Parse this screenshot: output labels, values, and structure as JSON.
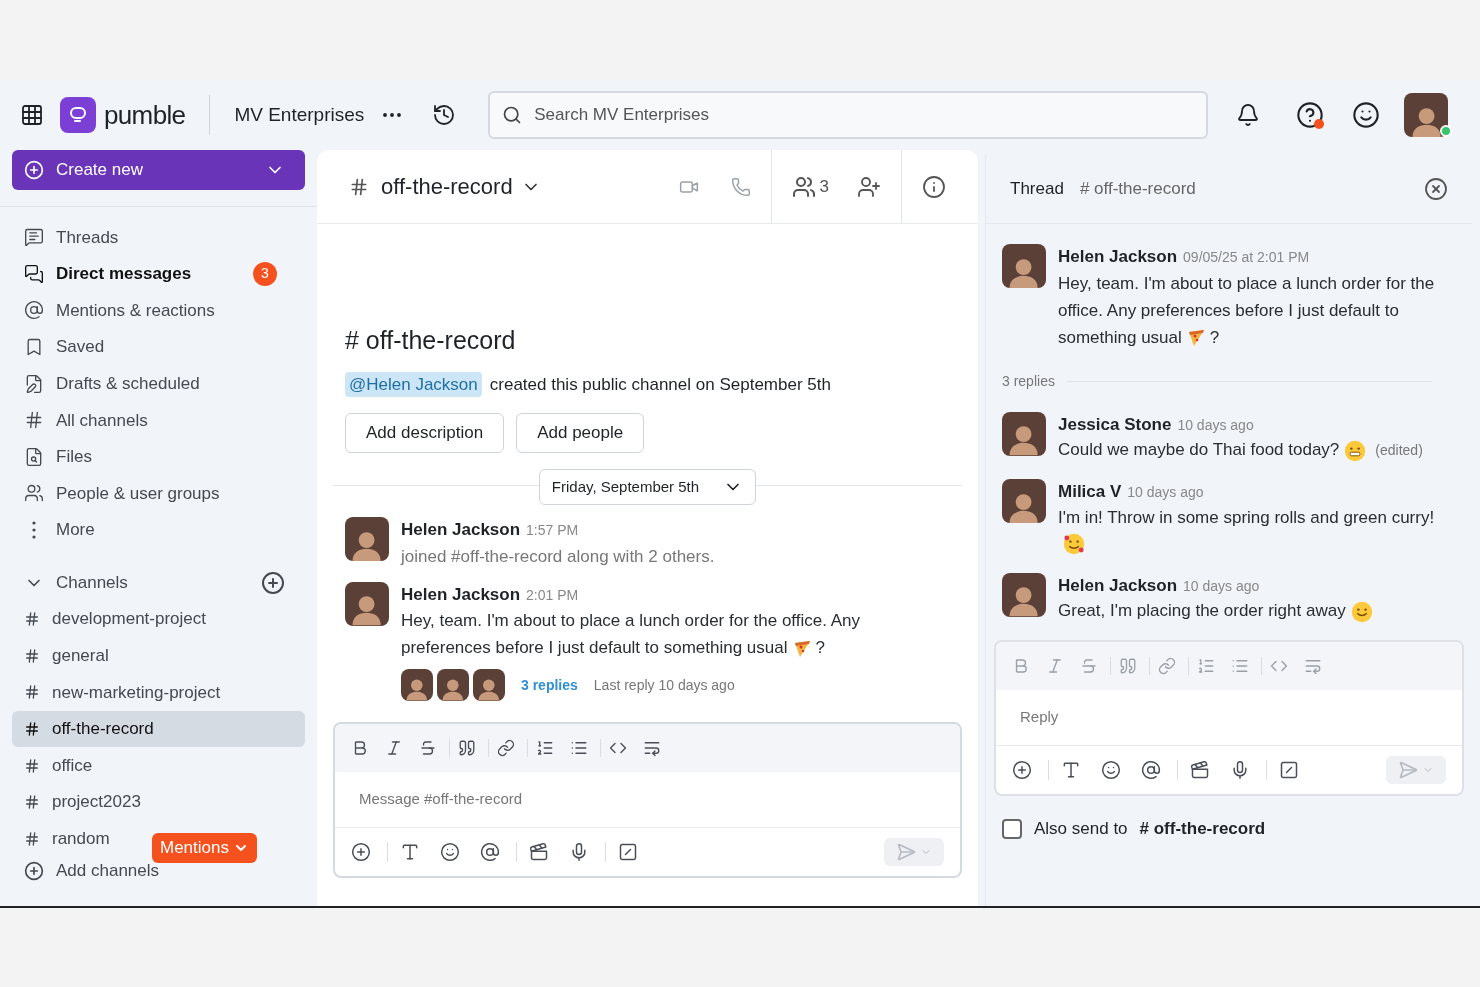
{
  "topbar": {
    "logo": "pumble",
    "workspace": "MV Enterprises",
    "search": {
      "placeholder": "Search MV Enterprises"
    }
  },
  "sidebar": {
    "create_button": "Create new",
    "nav": [
      {
        "label": "Threads",
        "unread": false
      },
      {
        "label": "Direct messages",
        "unread": true,
        "badge": "3"
      },
      {
        "label": "Mentions & reactions",
        "unread": false
      },
      {
        "label": "Saved",
        "unread": false
      },
      {
        "label": "Drafts & scheduled",
        "unread": false
      },
      {
        "label": "All channels",
        "unread": false
      },
      {
        "label": "Files",
        "unread": false
      },
      {
        "label": "People & user groups",
        "unread": false
      },
      {
        "label": "More",
        "unread": false
      }
    ],
    "channels_header": {
      "label": "Channels",
      "expanded": true
    },
    "channels": [
      {
        "name": "development-project",
        "selected": false
      },
      {
        "name": "general",
        "selected": false
      },
      {
        "name": "new-marketing-project",
        "selected": false
      },
      {
        "name": "off-the-record",
        "selected": true
      },
      {
        "name": "office",
        "selected": false
      },
      {
        "name": "project2023",
        "selected": false
      },
      {
        "name": "random",
        "selected": false
      }
    ],
    "add_channels": "Add channels",
    "mentions_badge": "Mentions"
  },
  "channel": {
    "name": "off-the-record",
    "member_count": "3",
    "intro": {
      "title": "# off-the-record",
      "mention": "@Helen Jackson",
      "text": "created this public channel on September 5th",
      "buttons": [
        "Add description",
        "Add people"
      ]
    },
    "date": "Friday, September 5th",
    "messages": [
      {
        "kind": "system",
        "author": "Helen Jackson",
        "time": "1:57 PM",
        "text": "joined #off-the-record along with 2 others."
      },
      {
        "kind": "normal",
        "author": "Helen Jackson",
        "time": "2:01 PM",
        "text": "Hey, team. I'm about to place a lunch order for the office. Any preferences before I just default to something usual",
        "after": "?",
        "replies": "3 replies",
        "last_reply": "Last reply 10 days ago"
      }
    ],
    "composer": {
      "placeholder": "Message #off-the-record"
    }
  },
  "thread": {
    "title": "Thread",
    "channel": "# off-the-record",
    "root": {
      "author": "Helen Jackson",
      "time": "09/05/25 at 2:01 PM",
      "text": "Hey, team. I'm about to place a lunch order for the office. Any preferences before I just default to something usual",
      "after": "?"
    },
    "replies_count": "3 replies",
    "replies": [
      {
        "author": "Jessica Stone",
        "time": "10 days ago",
        "text": "Could we maybe do Thai food today?",
        "edited": true,
        "edited_label": "(edited)"
      },
      {
        "author": "Milica V",
        "time": "10 days ago",
        "text": "I'm in! Throw in some spring rolls and green curry!",
        "edited": false
      },
      {
        "author": "Helen Jackson",
        "time": "10 days ago",
        "text": "Great, I'm placing the order right away",
        "edited": false
      }
    ],
    "reply": {
      "placeholder": "Reply"
    },
    "also_send": {
      "label": "Also send to",
      "channel": "# off-the-record",
      "checked": false
    }
  }
}
